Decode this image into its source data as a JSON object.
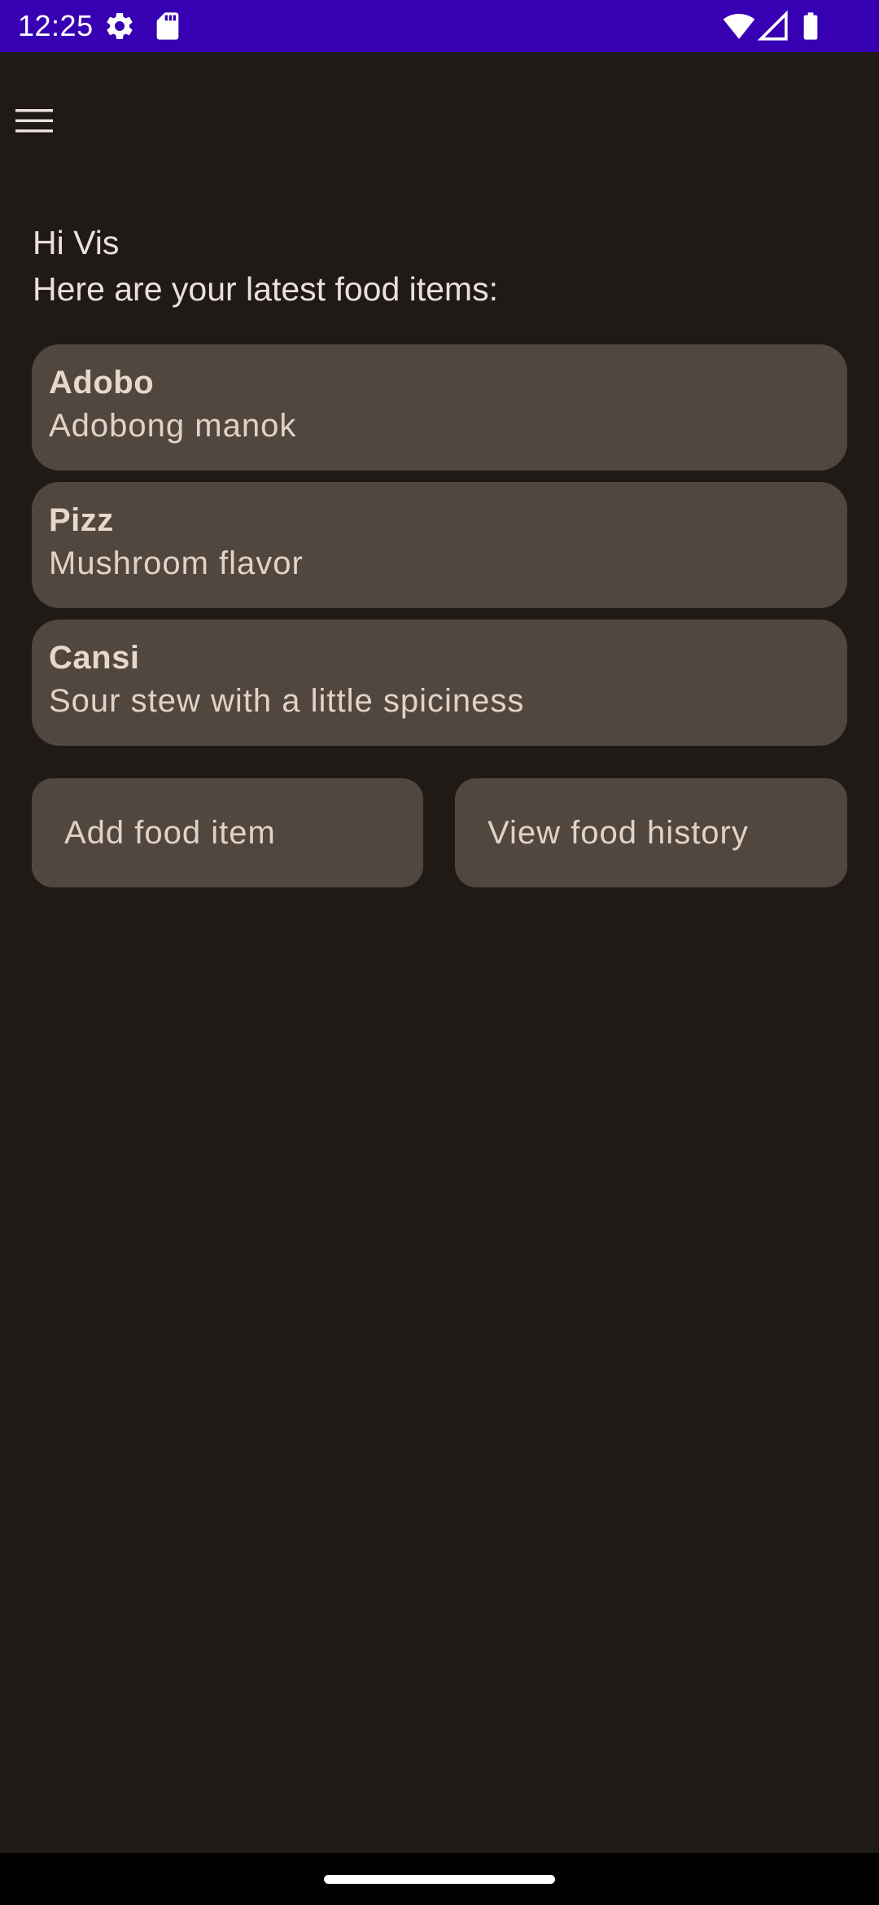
{
  "status_bar": {
    "time": "12:25",
    "icons": [
      "settings-icon",
      "sd-card-icon",
      "wifi-icon",
      "signal-icon",
      "battery-icon"
    ],
    "background_color": "#3700b3"
  },
  "app_bar": {
    "menu_icon": "hamburger-menu-icon"
  },
  "greeting": {
    "line1": "Hi Vis",
    "line2": "Here are your latest food items:"
  },
  "food_items": [
    {
      "name": "Adobo",
      "description": "Adobong manok"
    },
    {
      "name": "Pizz",
      "description": "Mushroom flavor"
    },
    {
      "name": "Cansi",
      "description": "Sour stew with a little spiciness"
    }
  ],
  "actions": {
    "add_label": "Add food item",
    "history_label": "View food history"
  },
  "colors": {
    "background": "#201a17",
    "card": "#51473f",
    "text": "#e2d2c6"
  }
}
